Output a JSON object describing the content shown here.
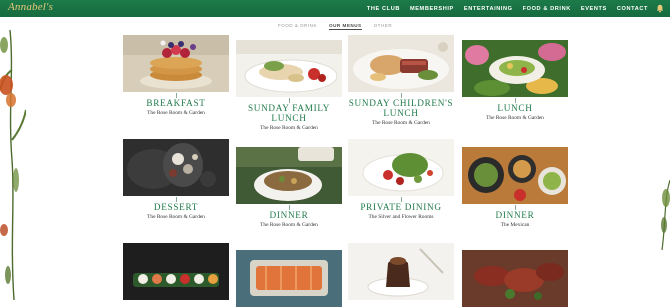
{
  "brand": {
    "logo": "Annabel's"
  },
  "nav": [
    "THE CLUB",
    "MEMBERSHIP",
    "ENTERTAINING",
    "FOOD & DRINK",
    "EVENTS",
    "CONTACT"
  ],
  "subnav": [
    {
      "label": "FOOD & DRINK",
      "active": false
    },
    {
      "label": "OUR MENUS",
      "active": true
    },
    {
      "label": "OTHER",
      "active": false
    }
  ],
  "menus": [
    {
      "title": "BREAKFAST",
      "venue": "The Rose Room & Garden"
    },
    {
      "title": "SUNDAY FAMILY LUNCH",
      "venue": "The Rose Room & Garden"
    },
    {
      "title": "SUNDAY CHILDREN'S LUNCH",
      "venue": "The Rose Room & Garden"
    },
    {
      "title": "LUNCH",
      "venue": "The Rose Room & Garden"
    },
    {
      "title": "DESSERT",
      "venue": "The Rose Room & Garden"
    },
    {
      "title": "DINNER",
      "venue": "The Rose Room & Garden"
    },
    {
      "title": "PRIVATE DINING",
      "venue": "The Silver and Flower Rooms"
    },
    {
      "title": "DINNER",
      "venue": "The Mexican"
    }
  ],
  "colors": {
    "brand_green": "#1c7a49",
    "title_green": "#1f7a4a",
    "logo_gold": "#e7c87a"
  },
  "icons": [
    "bell-icon"
  ]
}
